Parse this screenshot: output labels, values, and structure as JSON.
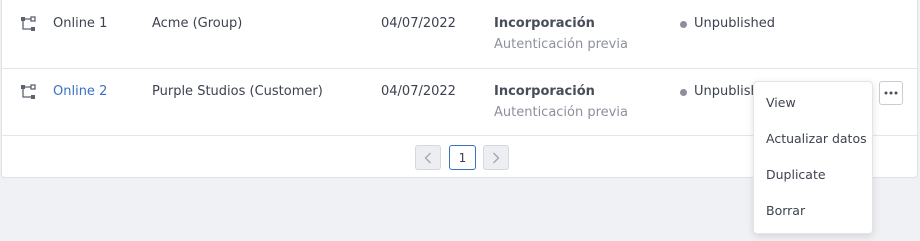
{
  "rows": [
    {
      "icon": "flow-icon",
      "name": "Online 1",
      "client": "Acme (Group)",
      "date": "04/07/2022",
      "type": "Incorporación",
      "subtype": "Autenticación previa",
      "status": "Unpublished"
    },
    {
      "icon": "flow-icon",
      "name": "Online 2",
      "client": "Purple Studios (Customer)",
      "date": "04/07/2022",
      "type": "Incorporación",
      "subtype": "Autenticación previa",
      "status": "Unpublished"
    }
  ],
  "pagination": {
    "current_page": "1",
    "prev_icon": "chevron-left-icon",
    "next_icon": "chevron-right-icon"
  },
  "row_menu": {
    "trigger_icon": "more-horizontal-icon",
    "items": [
      "View",
      "Actualizar datos",
      "Duplicate",
      "Borrar"
    ]
  },
  "colors": {
    "link": "#3b6fc4",
    "status_dot": "#8a8f99",
    "background": "#f0f1f4"
  }
}
